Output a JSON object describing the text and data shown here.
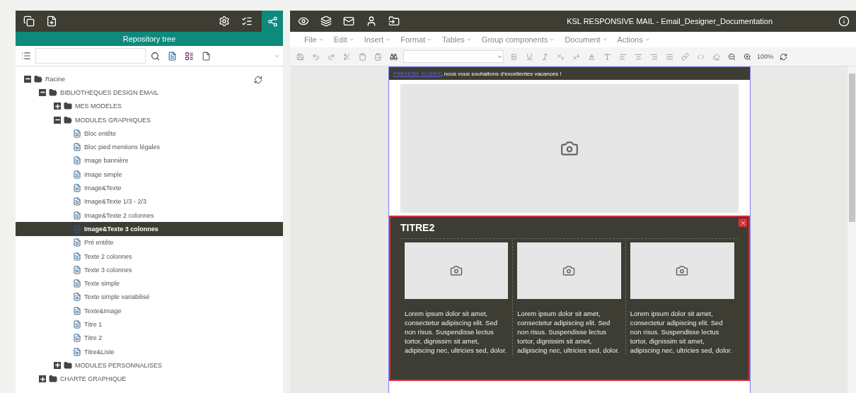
{
  "left_panel": {
    "title": "Repository tree",
    "tree": [
      {
        "label": "Racine",
        "kind": "folder",
        "expanded": true,
        "children": [
          {
            "label": "BIBLIOTHEQUES DESIGN EMAIL",
            "kind": "folder",
            "expanded": true,
            "children": [
              {
                "label": "MES MODELES",
                "kind": "folder",
                "expanded": false
              },
              {
                "label": "MODULES GRAPHIQUES",
                "kind": "folder",
                "expanded": true,
                "children": [
                  {
                    "label": "Bloc entête",
                    "kind": "file",
                    "selected": false
                  },
                  {
                    "label": "Bloc pied mentions légales",
                    "kind": "file",
                    "selected": false
                  },
                  {
                    "label": "Image bannière",
                    "kind": "file",
                    "selected": false
                  },
                  {
                    "label": "Image simple",
                    "kind": "file",
                    "selected": false
                  },
                  {
                    "label": "Image&Texte",
                    "kind": "file",
                    "selected": false
                  },
                  {
                    "label": "Image&Texte 1/3 - 2/3",
                    "kind": "file",
                    "selected": false
                  },
                  {
                    "label": "Image&Texte 2 colonnes",
                    "kind": "file",
                    "selected": false
                  },
                  {
                    "label": "Image&Texte 3 colonnes",
                    "kind": "file",
                    "selected": true
                  },
                  {
                    "label": "Pré entête",
                    "kind": "file",
                    "selected": false
                  },
                  {
                    "label": "Texte 2 colonnes",
                    "kind": "file",
                    "selected": false
                  },
                  {
                    "label": "Texte 3 colonnes",
                    "kind": "file",
                    "selected": false
                  },
                  {
                    "label": "Texte simple",
                    "kind": "file",
                    "selected": false
                  },
                  {
                    "label": "Texte simple variabilisé",
                    "kind": "file",
                    "selected": false
                  },
                  {
                    "label": "Texte&Image",
                    "kind": "file",
                    "selected": false
                  },
                  {
                    "label": "Titre 1",
                    "kind": "file",
                    "selected": false
                  },
                  {
                    "label": "Titre 2",
                    "kind": "file",
                    "selected": false
                  },
                  {
                    "label": "Titre&Liste",
                    "kind": "file",
                    "selected": false
                  }
                ]
              },
              {
                "label": "MODULES PERSONNALISES",
                "kind": "folder",
                "expanded": false
              }
            ]
          },
          {
            "label": "CHARTE GRAPHIQUE",
            "kind": "folder",
            "expanded": false
          }
        ]
      }
    ]
  },
  "editor": {
    "title": "KSL RESPONSIVE MAIL - Email_Designer_Documentation",
    "menus": [
      "File",
      "Edit",
      "Insert",
      "Format",
      "Tables",
      "Group components",
      "Document",
      "Actions"
    ],
    "zoom": "100%",
    "email": {
      "banner_variable": "PRENOM_CLIENT",
      "banner_text": ", nous vous souhaitons d'excellentes vacances !",
      "block_title": "TITRE2",
      "columns": [
        {
          "text": "Lorem ipsum dolor sit amet, consectetur adipiscing elit. Sed non risus. Suspendisse lectus tortor, dignissim sit amet, adipiscing nec, ultricies sed, dolor."
        },
        {
          "text": "Lorem ipsum dolor sit amet, consectetur adipiscing elit. Sed non risus. Suspendisse lectus tortor, dignissim sit amet, adipiscing nec, ultricies sed, dolor."
        },
        {
          "text": "Lorem ipsum dolor sit amet, consectetur adipiscing elit. Sed non risus. Suspendisse lectus tortor, dignissim sit amet, adipiscing nec, ultricies sed, dolor."
        }
      ]
    }
  }
}
